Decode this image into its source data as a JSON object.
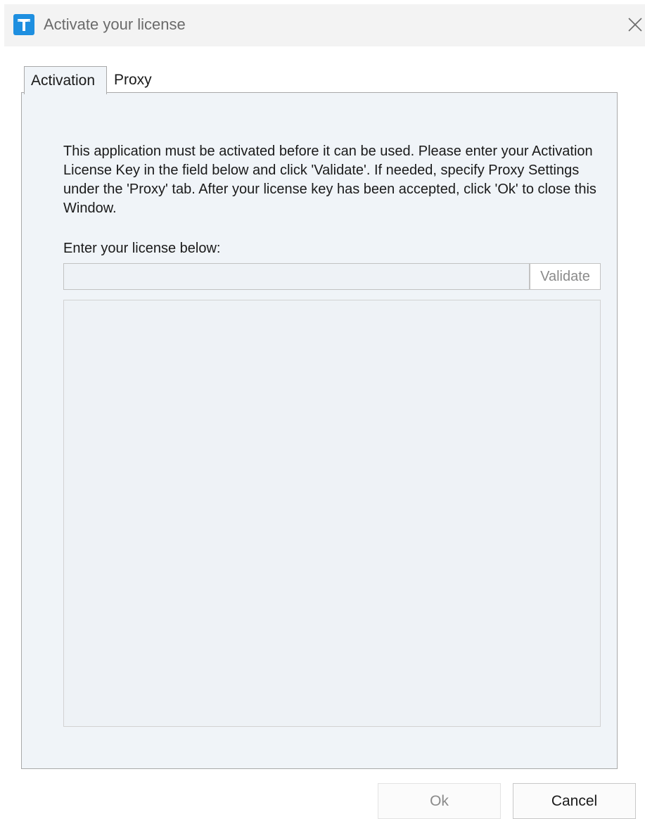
{
  "window": {
    "title": "Activate your license",
    "icon": "app-logo-icon",
    "close_icon": "close-icon",
    "accent_color": "#1e8fe0"
  },
  "tabs": [
    {
      "label": "Activation",
      "selected": true
    },
    {
      "label": "Proxy",
      "selected": false
    }
  ],
  "activation": {
    "instructions": "This application must be activated before it can be used. Please enter your Activation License Key in the field below and click 'Validate'. If needed, specify Proxy Settings under the 'Proxy' tab. After your license key has been accepted, click 'Ok' to close this Window.",
    "license_label": "Enter your license below:",
    "license_value": "",
    "validate_label": "Validate",
    "result_text": ""
  },
  "footer": {
    "ok_label": "Ok",
    "cancel_label": "Cancel"
  }
}
